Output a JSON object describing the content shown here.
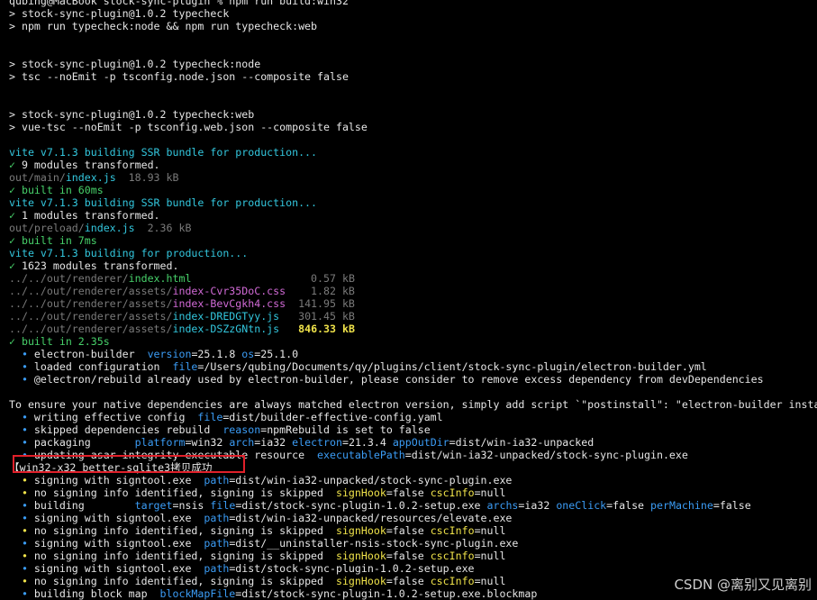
{
  "colors": {
    "background": "#000000",
    "text": "#e6e6e6",
    "cyan": "#33c7de",
    "green": "#47d16a",
    "gray": "#7a7a7a",
    "blue": "#3b9cf5",
    "magenta": "#d16ad6",
    "yellow": "#f0e34a",
    "highlight_box": "#e0202a"
  },
  "lines": [
    [
      {
        "t": "qubing@MacBook stock-sync-plugin % npm run build:win32",
        "c": "t"
      }
    ],
    [
      {
        "t": "> stock-sync-plugin@1.0.2 typecheck",
        "c": "t"
      }
    ],
    [
      {
        "t": "> npm run typecheck:node && npm run typecheck:web",
        "c": "t"
      }
    ],
    [
      {
        "t": "",
        "c": "t"
      }
    ],
    [
      {
        "t": "",
        "c": "t"
      }
    ],
    [
      {
        "t": "> stock-sync-plugin@1.0.2 typecheck:node",
        "c": "t"
      }
    ],
    [
      {
        "t": "> tsc --noEmit -p tsconfig.node.json --composite false",
        "c": "t"
      }
    ],
    [
      {
        "t": "",
        "c": "t"
      }
    ],
    [
      {
        "t": "",
        "c": "t"
      }
    ],
    [
      {
        "t": "> stock-sync-plugin@1.0.2 typecheck:web",
        "c": "t"
      }
    ],
    [
      {
        "t": "> vue-tsc --noEmit -p tsconfig.web.json --composite false",
        "c": "t"
      }
    ],
    [
      {
        "t": "",
        "c": "t"
      }
    ],
    [
      {
        "t": "vite v7.1.3 building SSR bundle for production...",
        "c": "cyan"
      }
    ],
    [
      {
        "t": "✓",
        "c": "green"
      },
      {
        "t": " 9 modules transformed.",
        "c": "t"
      }
    ],
    [
      {
        "t": "out/main/",
        "c": "gray"
      },
      {
        "t": "index.js",
        "c": "cyan"
      },
      {
        "t": "  18.93 kB",
        "c": "gray"
      }
    ],
    [
      {
        "t": "✓ built in 60ms",
        "c": "green"
      }
    ],
    [
      {
        "t": "vite v7.1.3 building SSR bundle for production...",
        "c": "cyan"
      }
    ],
    [
      {
        "t": "✓",
        "c": "green"
      },
      {
        "t": " 1 modules transformed.",
        "c": "t"
      }
    ],
    [
      {
        "t": "out/preload/",
        "c": "gray"
      },
      {
        "t": "index.js",
        "c": "cyan"
      },
      {
        "t": "  2.36 kB",
        "c": "gray"
      }
    ],
    [
      {
        "t": "✓ built in 7ms",
        "c": "green"
      }
    ],
    [
      {
        "t": "vite v7.1.3 building for production...",
        "c": "cyan"
      }
    ],
    [
      {
        "t": "✓",
        "c": "green"
      },
      {
        "t": " 1623 modules transformed.",
        "c": "t"
      }
    ],
    [
      {
        "t": "../../out/renderer/",
        "c": "gray"
      },
      {
        "t": "index.html",
        "c": "green"
      },
      {
        "t": "                   0.57 kB",
        "c": "gray"
      }
    ],
    [
      {
        "t": "../../out/renderer/assets/",
        "c": "gray"
      },
      {
        "t": "index-Cvr35DoC.css",
        "c": "magenta"
      },
      {
        "t": "    1.82 kB",
        "c": "gray"
      }
    ],
    [
      {
        "t": "../../out/renderer/assets/",
        "c": "gray"
      },
      {
        "t": "index-BevCgkh4.css",
        "c": "magenta"
      },
      {
        "t": "  141.95 kB",
        "c": "gray"
      }
    ],
    [
      {
        "t": "../../out/renderer/assets/",
        "c": "gray"
      },
      {
        "t": "index-DREDGTyy.js",
        "c": "cyan"
      },
      {
        "t": "   301.45 kB",
        "c": "gray"
      }
    ],
    [
      {
        "t": "../../out/renderer/assets/",
        "c": "gray"
      },
      {
        "t": "index-DSZzGNtn.js",
        "c": "cyan"
      },
      {
        "t": "   ",
        "c": "t"
      },
      {
        "t": "846.33 kB",
        "c": "yellow"
      }
    ],
    [
      {
        "t": "✓ built in 2.35s",
        "c": "green"
      }
    ],
    [
      {
        "t": "  • ",
        "c": "blue"
      },
      {
        "t": "electron-builder  ",
        "c": "t"
      },
      {
        "t": "version",
        "c": "blue"
      },
      {
        "t": "=25.1.8 ",
        "c": "t"
      },
      {
        "t": "os",
        "c": "blue"
      },
      {
        "t": "=25.1.0",
        "c": "t"
      }
    ],
    [
      {
        "t": "  • ",
        "c": "blue"
      },
      {
        "t": "loaded configuration  ",
        "c": "t"
      },
      {
        "t": "file",
        "c": "blue"
      },
      {
        "t": "=/Users/qubing/Documents/qy/plugins/client/stock-sync-plugin/electron-builder.yml",
        "c": "t"
      }
    ],
    [
      {
        "t": "  • ",
        "c": "blue"
      },
      {
        "t": "@electron/rebuild already used by electron-builder, please consider to remove excess dependency from devDependencies",
        "c": "t"
      }
    ],
    [
      {
        "t": "",
        "c": "t"
      }
    ],
    [
      {
        "t": "To ensure your native dependencies are always matched electron version, simply add script `\"postinstall\": \"electron-builder install-app-deps\"` to your `package.json`",
        "c": "t"
      }
    ],
    [
      {
        "t": "  • ",
        "c": "blue"
      },
      {
        "t": "writing effective config  ",
        "c": "t"
      },
      {
        "t": "file",
        "c": "blue"
      },
      {
        "t": "=dist/builder-effective-config.yaml",
        "c": "t"
      }
    ],
    [
      {
        "t": "  • ",
        "c": "blue"
      },
      {
        "t": "skipped dependencies rebuild  ",
        "c": "t"
      },
      {
        "t": "reason",
        "c": "blue"
      },
      {
        "t": "=npmRebuild is set to false",
        "c": "t"
      }
    ],
    [
      {
        "t": "  • ",
        "c": "blue"
      },
      {
        "t": "packaging       ",
        "c": "t"
      },
      {
        "t": "platform",
        "c": "blue"
      },
      {
        "t": "=win32 ",
        "c": "t"
      },
      {
        "t": "arch",
        "c": "blue"
      },
      {
        "t": "=ia32 ",
        "c": "t"
      },
      {
        "t": "electron",
        "c": "blue"
      },
      {
        "t": "=21.3.4 ",
        "c": "t"
      },
      {
        "t": "appOutDir",
        "c": "blue"
      },
      {
        "t": "=dist/win-ia32-unpacked",
        "c": "t"
      }
    ],
    [
      {
        "t": "  • ",
        "c": "blue"
      },
      {
        "t": "updating asar integrity executable resource  ",
        "c": "t"
      },
      {
        "t": "executablePath",
        "c": "blue"
      },
      {
        "t": "=dist/win-ia32-unpacked/stock-sync-plugin.exe",
        "c": "t"
      }
    ],
    [
      {
        "t": "【win32-x32 better-sqlite3拷贝成功",
        "c": "t"
      }
    ],
    [
      {
        "t": "  • ",
        "c": "ylw"
      },
      {
        "t": "signing with signtool.exe  ",
        "c": "t"
      },
      {
        "t": "path",
        "c": "blue"
      },
      {
        "t": "=dist/win-ia32-unpacked/stock-sync-plugin.exe",
        "c": "t"
      }
    ],
    [
      {
        "t": "  • ",
        "c": "ylw"
      },
      {
        "t": "no signing info identified, signing is skipped  ",
        "c": "t"
      },
      {
        "t": "signHook",
        "c": "ylw"
      },
      {
        "t": "=false ",
        "c": "t"
      },
      {
        "t": "cscInfo",
        "c": "ylw"
      },
      {
        "t": "=null",
        "c": "t"
      }
    ],
    [
      {
        "t": "  • ",
        "c": "blue"
      },
      {
        "t": "building        ",
        "c": "t"
      },
      {
        "t": "target",
        "c": "blue"
      },
      {
        "t": "=nsis ",
        "c": "t"
      },
      {
        "t": "file",
        "c": "blue"
      },
      {
        "t": "=dist/stock-sync-plugin-1.0.2-setup.exe ",
        "c": "t"
      },
      {
        "t": "archs",
        "c": "blue"
      },
      {
        "t": "=ia32 ",
        "c": "t"
      },
      {
        "t": "oneClick",
        "c": "blue"
      },
      {
        "t": "=false ",
        "c": "t"
      },
      {
        "t": "perMachine",
        "c": "blue"
      },
      {
        "t": "=false",
        "c": "t"
      }
    ],
    [
      {
        "t": "  • ",
        "c": "blue"
      },
      {
        "t": "signing with signtool.exe  ",
        "c": "t"
      },
      {
        "t": "path",
        "c": "blue"
      },
      {
        "t": "=dist/win-ia32-unpacked/resources/elevate.exe",
        "c": "t"
      }
    ],
    [
      {
        "t": "  • ",
        "c": "ylw"
      },
      {
        "t": "no signing info identified, signing is skipped  ",
        "c": "t"
      },
      {
        "t": "signHook",
        "c": "ylw"
      },
      {
        "t": "=false ",
        "c": "t"
      },
      {
        "t": "cscInfo",
        "c": "ylw"
      },
      {
        "t": "=null",
        "c": "t"
      }
    ],
    [
      {
        "t": "  • ",
        "c": "blue"
      },
      {
        "t": "signing with signtool.exe  ",
        "c": "t"
      },
      {
        "t": "path",
        "c": "blue"
      },
      {
        "t": "=dist/__uninstaller-nsis-stock-sync-plugin.exe",
        "c": "t"
      }
    ],
    [
      {
        "t": "  • ",
        "c": "ylw"
      },
      {
        "t": "no signing info identified, signing is skipped  ",
        "c": "t"
      },
      {
        "t": "signHook",
        "c": "ylw"
      },
      {
        "t": "=false ",
        "c": "t"
      },
      {
        "t": "cscInfo",
        "c": "ylw"
      },
      {
        "t": "=null",
        "c": "t"
      }
    ],
    [
      {
        "t": "  • ",
        "c": "blue"
      },
      {
        "t": "signing with signtool.exe  ",
        "c": "t"
      },
      {
        "t": "path",
        "c": "blue"
      },
      {
        "t": "=dist/stock-sync-plugin-1.0.2-setup.exe",
        "c": "t"
      }
    ],
    [
      {
        "t": "  • ",
        "c": "ylw"
      },
      {
        "t": "no signing info identified, signing is skipped  ",
        "c": "t"
      },
      {
        "t": "signHook",
        "c": "ylw"
      },
      {
        "t": "=false ",
        "c": "t"
      },
      {
        "t": "cscInfo",
        "c": "ylw"
      },
      {
        "t": "=null",
        "c": "t"
      }
    ],
    [
      {
        "t": "  • ",
        "c": "blue"
      },
      {
        "t": "building block map  ",
        "c": "t"
      },
      {
        "t": "blockMapFile",
        "c": "blue"
      },
      {
        "t": "=dist/stock-sync-plugin-1.0.2-setup.exe.blockmap",
        "c": "t"
      }
    ]
  ],
  "watermark": "CSDN @离别又见离别"
}
